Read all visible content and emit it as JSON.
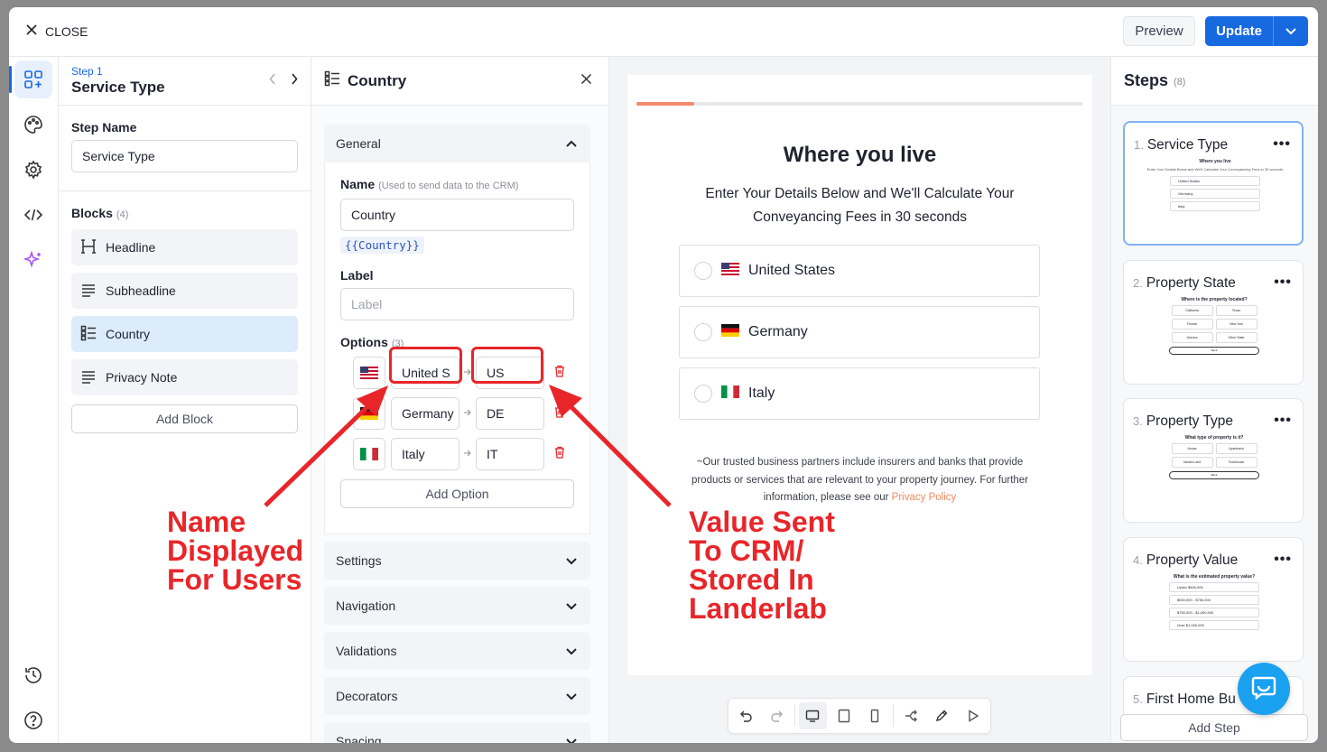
{
  "topbar": {
    "close_label": "CLOSE",
    "preview_label": "Preview",
    "update_label": "Update"
  },
  "rail": {
    "icons": [
      "blocks-icon",
      "palette-icon",
      "gear-icon",
      "code-icon",
      "sparkle-icon",
      "history-icon",
      "help-icon"
    ]
  },
  "step": {
    "number_label": "Step 1",
    "title": "Service Type",
    "step_name_label": "Step Name",
    "step_name_value": "Service Type",
    "blocks_label": "Blocks",
    "blocks_count": "(4)",
    "blocks": [
      {
        "label": "Headline",
        "icon": "heading-icon"
      },
      {
        "label": "Subheadline",
        "icon": "text-lines-icon"
      },
      {
        "label": "Country",
        "icon": "list-icon"
      },
      {
        "label": "Privacy Note",
        "icon": "text-lines-icon"
      }
    ],
    "add_block_label": "Add Block"
  },
  "properties": {
    "title": "Country",
    "general_label": "General",
    "name_label": "Name",
    "name_hint": "(Used to send data to the CRM)",
    "name_value": "Country",
    "variable_token": "{{Country}}",
    "label_label": "Label",
    "label_placeholder": "Label",
    "options_label": "Options",
    "options_count": "(3)",
    "options": [
      {
        "name": "United S",
        "value": "US"
      },
      {
        "name": "Germany",
        "value": "DE"
      },
      {
        "name": "Italy",
        "value": "IT"
      }
    ],
    "add_option_label": "Add Option",
    "sections": [
      "Settings",
      "Navigation",
      "Validations",
      "Decorators",
      "Spacing"
    ]
  },
  "preview": {
    "progress": 0.13,
    "title": "Where you live",
    "subtitle": "Enter Your Details Below and We'll Calculate Your Conveyancing Fees in 30 seconds",
    "choices": [
      "United States",
      "Germany",
      "Italy"
    ],
    "note": "~Our trusted business partners include insurers and banks that provide products or services that are relevant to your property journey. For further information, please see our",
    "note_link": "Privacy Policy",
    "colors": {
      "accent": "#f08a5d",
      "primary": "#1769e0",
      "annotation": "#e8262a"
    }
  },
  "steps": {
    "title": "Steps",
    "count": "(8)",
    "cards": [
      {
        "num": "1.",
        "title": "Service Type",
        "mini_title": "Where you live",
        "mini_sub": "Enter Your Details Below and We'll Calculate Your Conveyancing Fees in 30 seconds",
        "mini_rows": [
          "United States",
          "Germany",
          "Italy"
        ]
      },
      {
        "num": "2.",
        "title": "Property State",
        "mini_title": "Where is the property located?",
        "mini_grid": [
          "California",
          "Texas",
          "Florida",
          "New York",
          "Arizona",
          "Other State"
        ],
        "mini_back": "Back"
      },
      {
        "num": "3.",
        "title": "Property Type",
        "mini_title": "What type of property is it?",
        "mini_grid": [
          "House",
          "Apartment",
          "Vacant Land",
          "Townhouse"
        ],
        "mini_back": "Back"
      },
      {
        "num": "4.",
        "title": "Property Value",
        "mini_title": "What is the estimated property value?",
        "mini_rows": [
          "Under $500,000",
          "$500,000 - $750,000",
          "$750,000 - $1,000,000",
          "Over $1,000,000"
        ]
      },
      {
        "num": "5.",
        "title": "First Home Bu"
      }
    ],
    "add_step_label": "Add Step"
  },
  "annotations": {
    "left": [
      "Name",
      "Displayed",
      "For Users"
    ],
    "right": [
      "Value Sent",
      "To CRM/",
      "Stored In",
      "Landerlab"
    ]
  }
}
